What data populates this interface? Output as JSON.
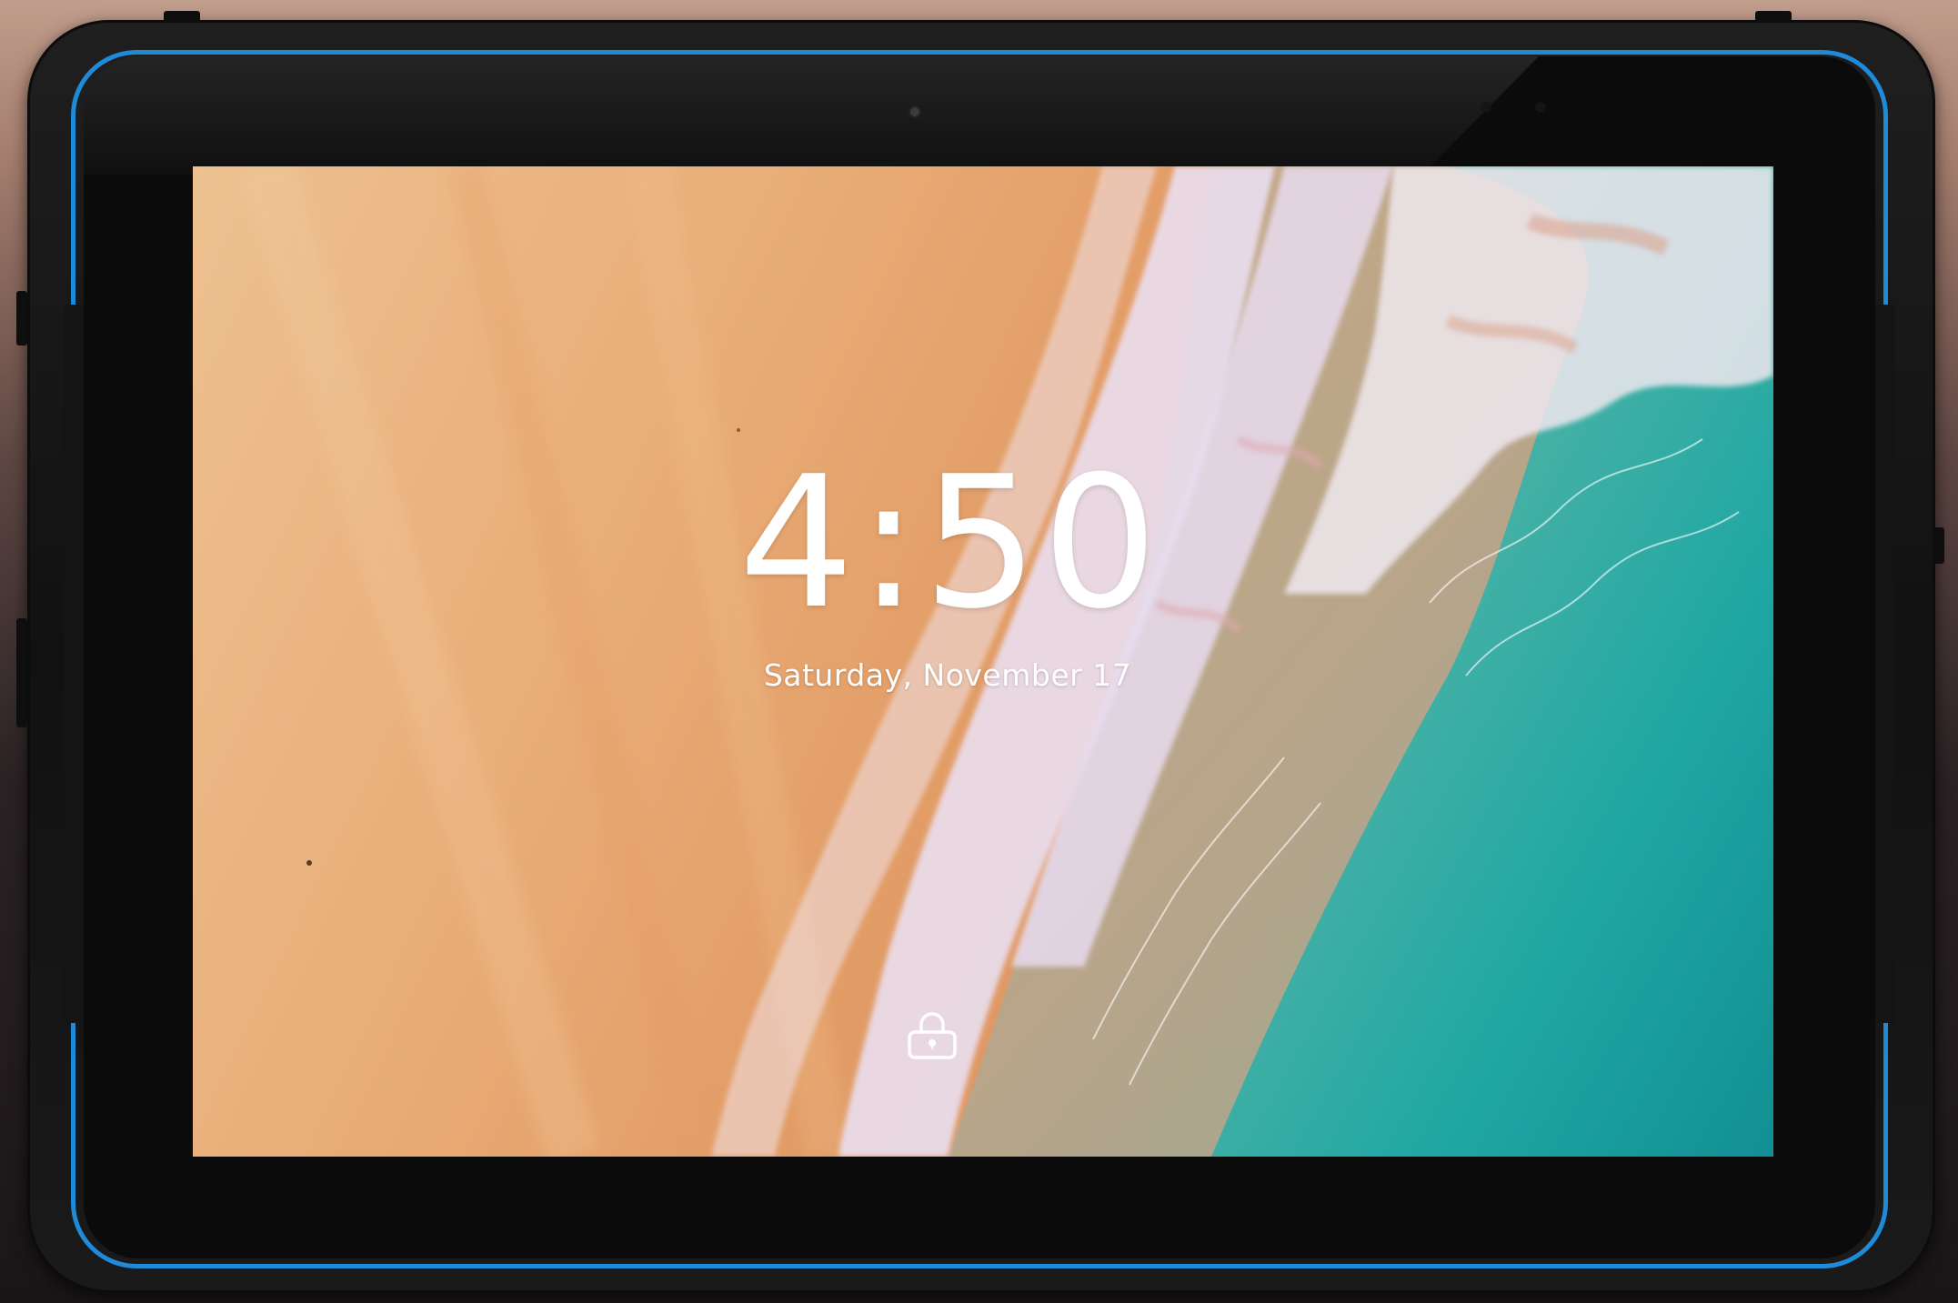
{
  "lockscreen": {
    "time": "4:50",
    "date": "Saturday, November 17",
    "unlock_icon": "unlock-icon"
  },
  "device": {
    "accent_color": "#1f8bd8",
    "frame_color": "#111111"
  }
}
